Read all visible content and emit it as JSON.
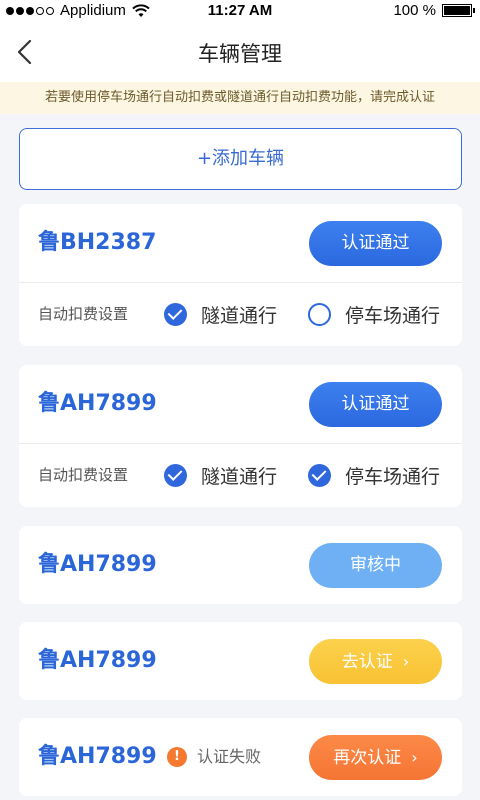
{
  "status_bar": {
    "carrier": "Applidium",
    "time": "11:27 AM",
    "battery": "100 %",
    "battery_level": 1.0,
    "signal_bars": 3,
    "signal_total": 5
  },
  "nav": {
    "title": "车辆管理",
    "back_icon": "chevron-left-icon"
  },
  "notice": "若要使用停车场通行自动扣费或隧道通行自动扣费功能，请完成认证",
  "add_button": "+添加车辆",
  "setting_label": "自动扣费设置",
  "options": {
    "tunnel": "隧道通行",
    "parking": "停车场通行"
  },
  "vehicles": [
    {
      "plate": "鲁BH2387",
      "status_label": "认证通过",
      "tunnel_checked": true,
      "parking_checked": false
    },
    {
      "plate": "鲁AH7899",
      "status_label": "认证通过",
      "tunnel_checked": true,
      "parking_checked": true
    },
    {
      "plate": "鲁AH7899",
      "status_label": "审核中"
    },
    {
      "plate": "鲁AH7899",
      "status_label": "去认证",
      "chevron": "›"
    },
    {
      "plate": "鲁AH7899",
      "status_label": "再次认证",
      "chevron": "›",
      "fail_text": "认证失败",
      "fail_icon_glyph": "!"
    }
  ],
  "colors": {
    "primary": "#2f68dc",
    "pending": "#6fb0f5",
    "warning": "#f8c234",
    "danger": "#f57433"
  }
}
